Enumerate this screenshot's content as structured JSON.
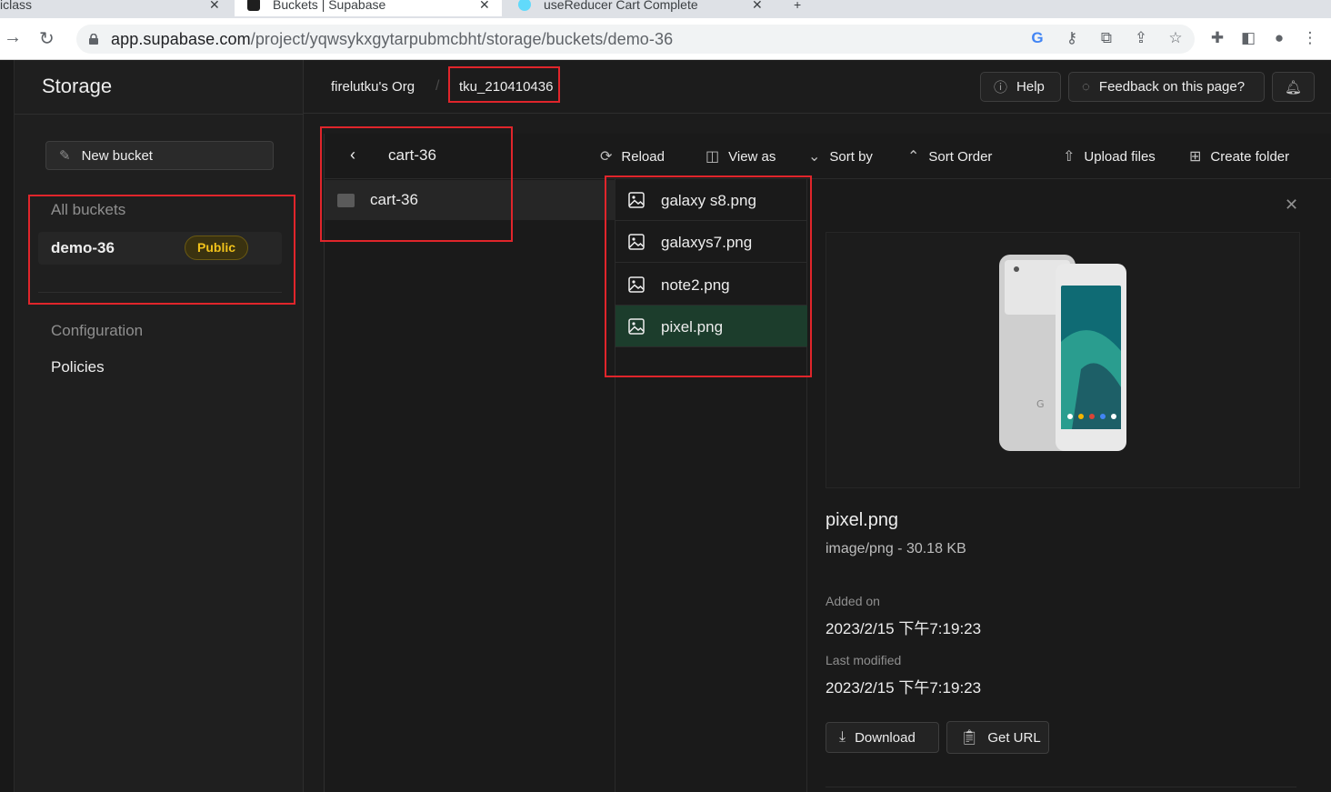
{
  "browser": {
    "tabs": [
      {
        "title": "iclass"
      },
      {
        "title": "Buckets | Supabase"
      },
      {
        "title": "useReducer Cart Complete"
      }
    ],
    "url_host": "app.supabase.com",
    "url_path": "/project/yqwsykxgytarpubmcbht/storage/buckets/demo-36"
  },
  "sidebar": {
    "title": "Storage",
    "new_bucket_label": "New bucket",
    "all_buckets_label": "All buckets",
    "bucket": {
      "name": "demo-36",
      "badge": "Public"
    },
    "configuration_label": "Configuration",
    "policies_label": "Policies"
  },
  "header": {
    "org": "firelutku's Org",
    "project": "tku_210410436",
    "help_label": "Help",
    "feedback_label": "Feedback on this page?"
  },
  "toolbar": {
    "reload": "Reload",
    "view_as": "View as",
    "sort_by": "Sort by",
    "sort_order": "Sort Order",
    "upload": "Upload files",
    "create_folder": "Create folder"
  },
  "explorer": {
    "column_title": "cart-36",
    "folders": [
      "cart-36"
    ],
    "files": [
      "galaxy s8.png",
      "galaxys7.png",
      "note2.png",
      "pixel.png"
    ],
    "selected_file_index": 3
  },
  "preview": {
    "name": "pixel.png",
    "meta": "image/png - 30.18 KB",
    "added_label": "Added on",
    "added_value": "2023/2/15 下午7:19:23",
    "modified_label": "Last modified",
    "modified_value": "2023/2/15 下午7:19:23",
    "download_label": "Download",
    "get_url_label": "Get URL"
  },
  "colors": {
    "accent_red": "#e0252b",
    "selected_row": "#1c3d2c",
    "badge_yellow": "#f1c21b"
  }
}
